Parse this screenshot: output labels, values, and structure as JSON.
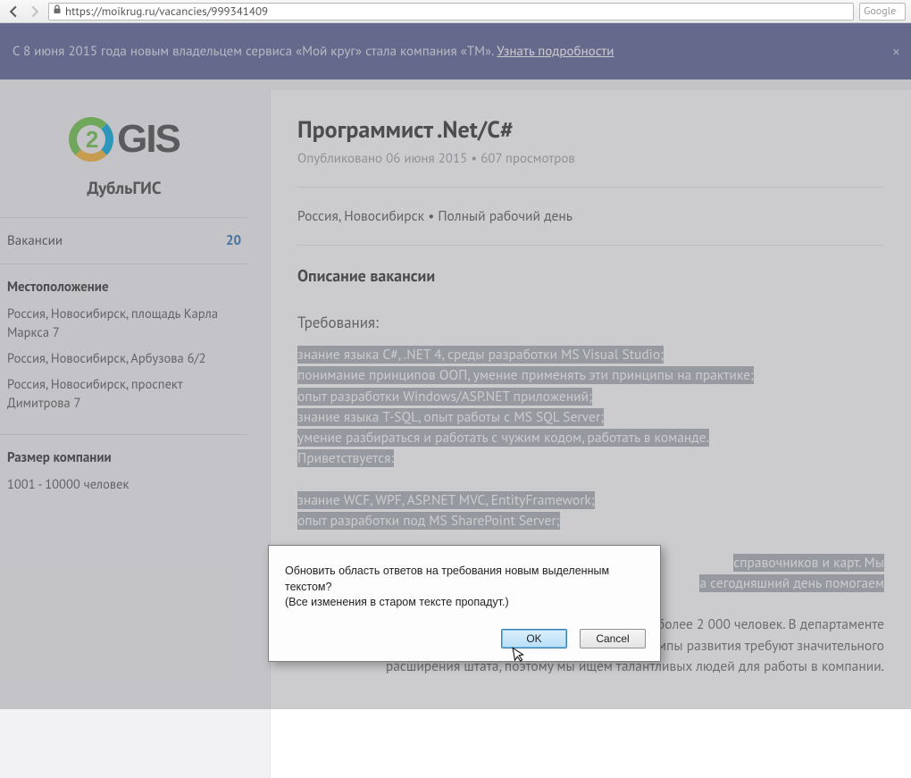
{
  "browser": {
    "url": "https://moikrug.ru/vacancies/999341409",
    "search_placeholder": "Google"
  },
  "banner": {
    "text_before": "С 8 июня 2015 года новым владельцем сервиса «Мой круг» стала компания «TM». ",
    "link": "Узнать подробности"
  },
  "company": {
    "logo_text": "GIS",
    "logo_digit": "2",
    "name": "ДубльГИС"
  },
  "sidebar": {
    "vacancies_label": "Вакансии",
    "vacancies_count": "20",
    "location_title": "Местоположение",
    "addresses": [
      "Россия, Новосибирск, площадь Карла Маркса 7",
      "Россия, Новосибирск, Арбузова 6/2",
      "Россия, Новосибирск, проспект Димитрова 7"
    ],
    "size_title": "Размер компании",
    "size_value": "1001 - 10000 человек"
  },
  "vacancy": {
    "title": "Программист .Net/C#",
    "meta": "Опубликовано 06 июня 2015 • 607 просмотров",
    "location": "Россия, Новосибирск • Полный рабочий день",
    "desc_header": "Описание вакансии",
    "req_header": "Требования:",
    "req_lines": [
      "знание языка C#, .NET 4, среды разработки MS Visual Studio;",
      "понимание принципов ООП, умение применять эти принципы на практике;",
      "опыт разработки Windows/ASP.NET приложений;",
      "знание языка T-SQL, опыт работы с MS SQL Server;",
      "умение разбираться и работать с чужим кодом, работать в команде.",
      "Приветствуется:"
    ],
    "req_lines2": [
      "знание WCF, WPF, ASP.NET MVC, EntityFramework;",
      "опыт разработки под MS SharePoint Server;"
    ],
    "frag_a": "справочников и карт. Мы",
    "frag_b": "а сегодняшний день помогаем",
    "para_tail": " их количество постоянно растет. В компании работает более 2 000 человек. В департаменте разработки ПО более 200 IT-специалистов. Наши темпы развития требуют значительного расширения штата, поэтому мы ищем талантливых людей для работы в компании."
  },
  "dialog": {
    "line1": "Обновить область ответов на требования новым выделенным текстом?",
    "line2": "(Все изменения в старом тексте пропадут.)",
    "ok": "OK",
    "cancel": "Cancel"
  }
}
